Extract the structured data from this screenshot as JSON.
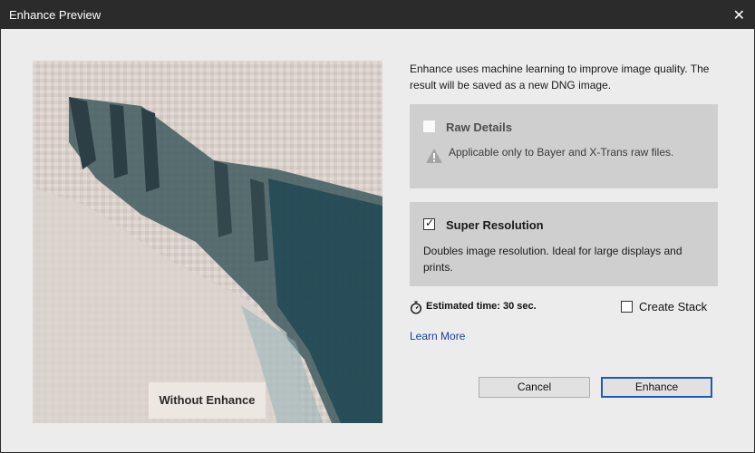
{
  "window": {
    "title": "Enhance Preview"
  },
  "preview": {
    "overlay_label": "Without Enhance"
  },
  "description": "Enhance uses machine learning to improve image quality. The result will be saved as a new DNG image.",
  "options": {
    "raw_details": {
      "label": "Raw Details",
      "checked": false,
      "enabled": false,
      "note": "Applicable only to Bayer and X-Trans raw files."
    },
    "super_resolution": {
      "label": "Super Resolution",
      "checked": true,
      "description": "Doubles image resolution. Ideal for large displays and prints."
    }
  },
  "estimate": {
    "text": "Estimated time: 30 sec."
  },
  "create_stack": {
    "label": "Create Stack",
    "checked": false
  },
  "learn_more": "Learn More",
  "buttons": {
    "cancel": "Cancel",
    "enhance": "Enhance"
  },
  "icons": {
    "close": "close-icon",
    "timer": "stopwatch-icon",
    "warning": "warning-icon"
  },
  "colors": {
    "titlebar": "#2b2b2b",
    "accent": "#1e5cb3",
    "link": "#1a3f9c",
    "panel": "#cfcfcf"
  }
}
